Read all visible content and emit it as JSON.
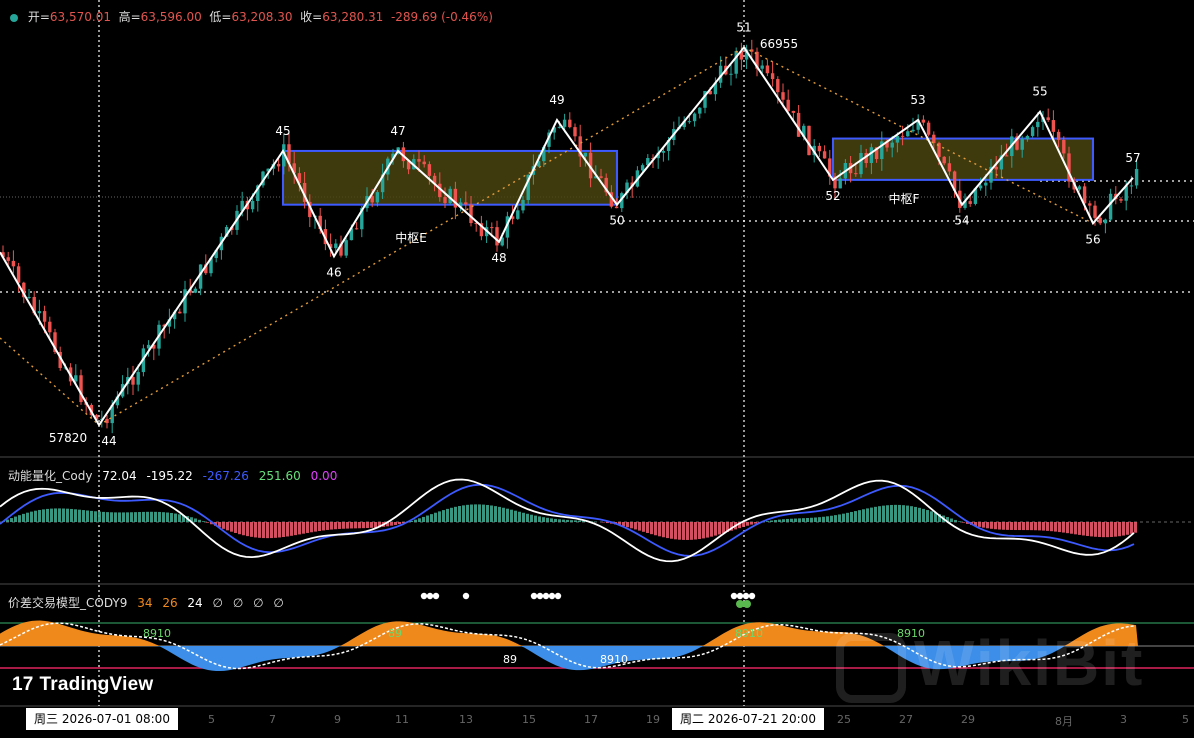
{
  "header": {
    "open_label": "开=",
    "open": "63,570.01",
    "high_label": "高=",
    "high": "63,596.00",
    "low_label": "低=",
    "low": "63,208.30",
    "close_label": "收=",
    "close": "63,280.31",
    "change": "-289.69 (-0.46%)"
  },
  "indicator1": {
    "name": "动能量化_Cody",
    "v1": "72.04",
    "v2": "-195.22",
    "v3": "-267.26",
    "v4": "251.60",
    "v5": "0.00"
  },
  "indicator2": {
    "name": "价差交易模型_CODY9",
    "v1": "34",
    "v2": "26",
    "v3": "24",
    "flags": [
      "∅",
      "∅",
      "∅",
      "∅"
    ]
  },
  "branding": {
    "logo": "TradingView",
    "watermark": "WikiBit"
  },
  "time_axis": {
    "tag_left": "周三 2026-07-01   08:00",
    "tag_right": "周二 2026-07-21   20:00",
    "ticks": [
      "5",
      "7",
      "9",
      "11",
      "13",
      "15",
      "17",
      "19",
      "25",
      "27",
      "29",
      "8月",
      "3",
      "5"
    ]
  },
  "colors": {
    "up": "#26a69a",
    "down": "#ef5350",
    "zone_border": "#3d5afe",
    "zone_fill": "#4a4410",
    "zigzag": "#ffffff",
    "trend": "#e39b3a",
    "orange_area": "#f0891c",
    "blue_area": "#3c8ee8"
  },
  "chart_data": {
    "type": "candlestick",
    "title": "",
    "zigzag_points": [
      {
        "label": "44",
        "value": 57820
      },
      {
        "label": "45",
        "value": 64450
      },
      {
        "label": "46",
        "value": 61900
      },
      {
        "label": "47",
        "value": 64450
      },
      {
        "label": "48",
        "value": 62250
      },
      {
        "label": "49",
        "value": 65200
      },
      {
        "label": "50",
        "value": 63150
      },
      {
        "label": "51",
        "value": 66955
      },
      {
        "label": "52",
        "value": 63750
      },
      {
        "label": "53",
        "value": 65200
      },
      {
        "label": "54",
        "value": 63150
      },
      {
        "label": "55",
        "value": 65400
      },
      {
        "label": "56",
        "value": 62700
      },
      {
        "label": "57",
        "value": 63800
      }
    ],
    "annotations": [
      {
        "text": "57820"
      },
      {
        "text": "66955"
      },
      {
        "text": "中枢E"
      },
      {
        "text": "中枢F"
      }
    ],
    "zones": [
      {
        "name": "中枢E",
        "from": "45",
        "to": "50",
        "low": 63150,
        "high": 64450
      },
      {
        "name": "中枢F",
        "from": "52",
        "to": "56",
        "low": 63750,
        "high": 64750
      }
    ],
    "histogram_labels": [
      "8910",
      "89",
      "89",
      "8910",
      "8910",
      "8910"
    ]
  }
}
